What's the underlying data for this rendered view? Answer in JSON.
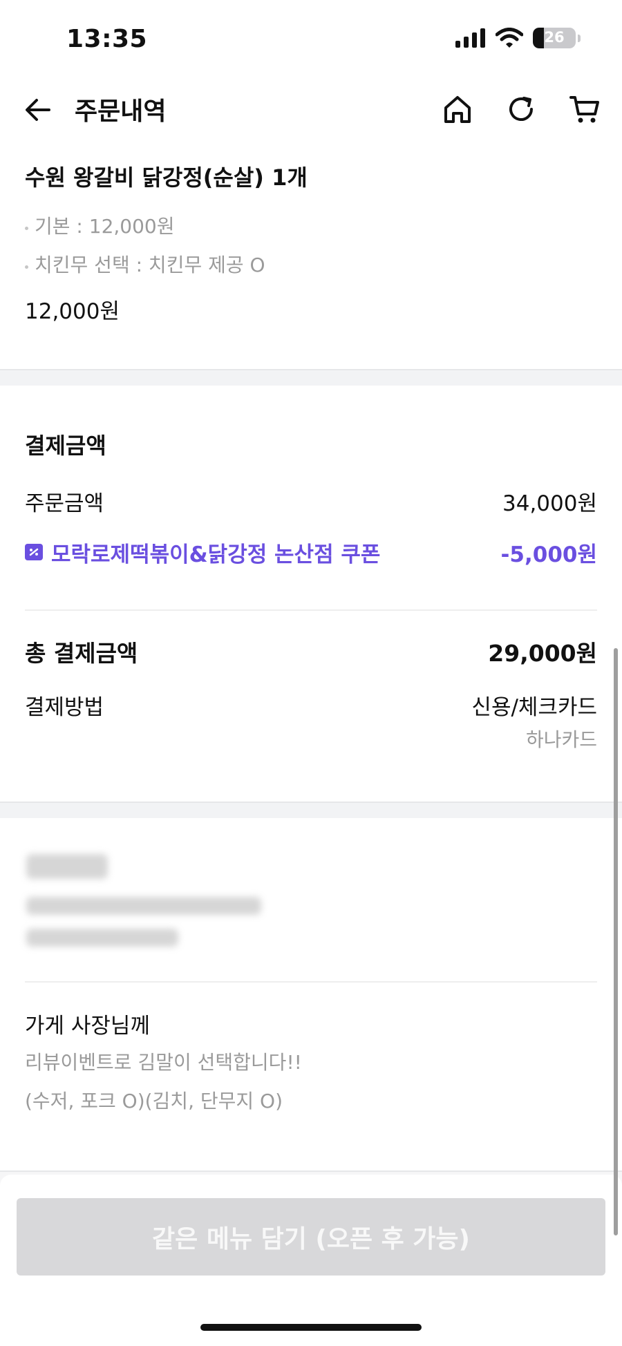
{
  "status_bar": {
    "time": "13:35",
    "battery": "26",
    "battery_level": 0.26
  },
  "nav": {
    "title": "주문내역"
  },
  "item": {
    "name": "수원 왕갈비 닭강정(순살) 1개",
    "options": [
      "기본 : 12,000원",
      "치킨무 선택 : 치킨무 제공 O"
    ],
    "price": "12,000원"
  },
  "payment": {
    "title": "결제금액",
    "order_label": "주문금액",
    "order_value": "34,000원",
    "coupon_label": "모락로제떡볶이&닭강정 논산점 쿠폰",
    "coupon_value": "-5,000원",
    "total_label": "총 결제금액",
    "total_value": "29,000원",
    "method_label": "결제방법",
    "method_value": "신용/체크카드",
    "method_sub": "하나카드"
  },
  "request": {
    "title": "가게 사장님께",
    "lines": [
      "리뷰이벤트로 김말이 선택합니다!!",
      "(수저, 포크 O)(김치, 단무지 O)"
    ]
  },
  "cta": {
    "label": "같은 메뉴 담기 (오픈 후 가능)"
  },
  "colors": {
    "accent": "#6a4fe0",
    "muted": "#9a9a9a",
    "disabled": "#d8d8da"
  }
}
